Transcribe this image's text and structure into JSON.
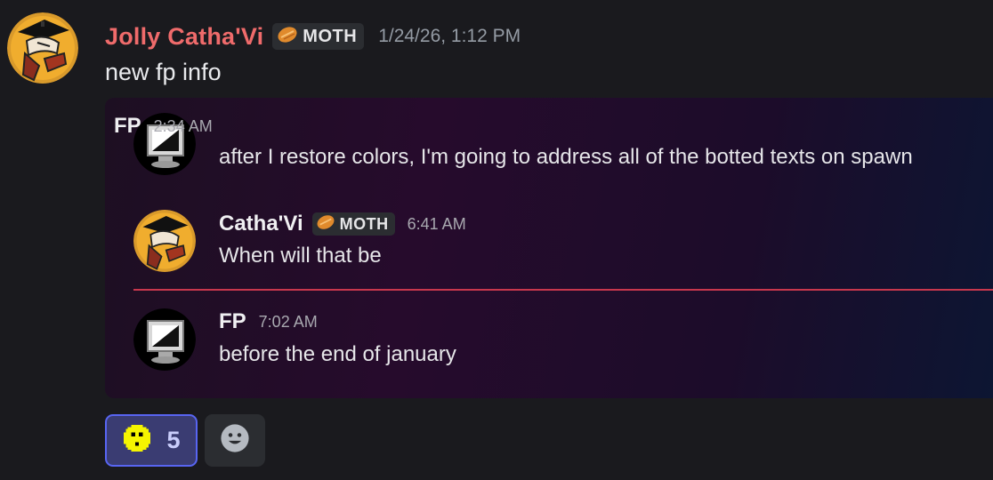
{
  "message": {
    "author": "Jolly Catha'Vi",
    "tag": "MOTH",
    "timestamp": "1/24/26, 1:12 PM",
    "content": "new fp info"
  },
  "forwarded": [
    {
      "author": "FP",
      "time": "2:34 AM",
      "text": "after I restore colors, I'm going to address all of the botted texts on spawn",
      "avatar": "computer-monitor-icon"
    },
    {
      "author": "Catha'Vi",
      "tag": "MOTH",
      "time": "6:41 AM",
      "text": "When will that be",
      "avatar": "graduate-avatar"
    },
    {
      "author": "FP",
      "time": "7:02 AM",
      "text": "before the end of january",
      "avatar": "computer-monitor-icon"
    }
  ],
  "reactions": [
    {
      "emoji": "yellow-smiley-pixel-icon",
      "count": "5"
    }
  ],
  "add_reaction_icon": "add-reaction-smiley-icon",
  "colors": {
    "author_name": "#ef6b6b",
    "new_divider": "#c8374d",
    "reaction_active_border": "#5865f2"
  }
}
